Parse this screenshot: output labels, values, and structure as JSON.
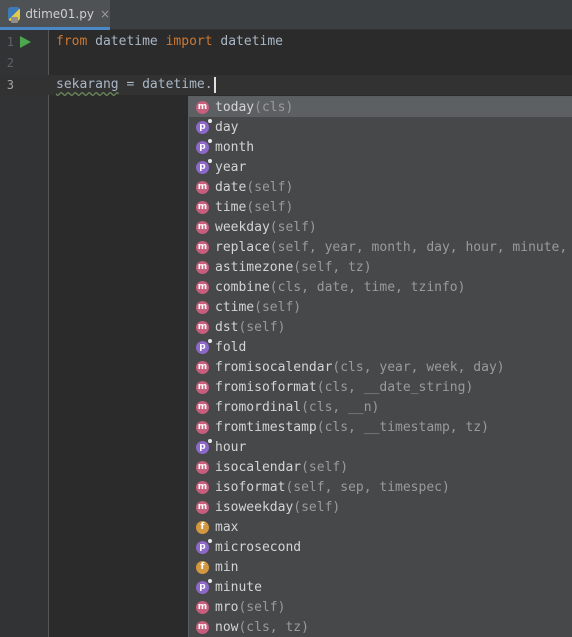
{
  "tab": {
    "filename": "dtime01.py",
    "close_symbol": "×"
  },
  "colors": {
    "keyword": "#cc7832",
    "text": "#a9b7c6",
    "method_badge": "#c75e7b",
    "property_badge": "#8c68c9",
    "field_badge": "#d3983f",
    "run": "#4ca74f"
  },
  "editor": {
    "lines": [
      {
        "number": "1",
        "kw1": "from",
        "mod": " datetime ",
        "kw2": "import",
        "name": " datetime"
      },
      {
        "number": "2"
      },
      {
        "number": "3",
        "var": "sekarang",
        "rest": " = datetime."
      }
    ]
  },
  "completion": {
    "items": [
      {
        "kind": "m",
        "name": "today",
        "sig": "(cls)"
      },
      {
        "kind": "p",
        "name": "day",
        "sig": ""
      },
      {
        "kind": "p",
        "name": "month",
        "sig": ""
      },
      {
        "kind": "p",
        "name": "year",
        "sig": ""
      },
      {
        "kind": "m",
        "name": "date",
        "sig": "(self)"
      },
      {
        "kind": "m",
        "name": "time",
        "sig": "(self)"
      },
      {
        "kind": "m",
        "name": "weekday",
        "sig": "(self)"
      },
      {
        "kind": "m",
        "name": "replace",
        "sig": "(self, year, month, day, hour, minute,"
      },
      {
        "kind": "m",
        "name": "astimezone",
        "sig": "(self, tz)"
      },
      {
        "kind": "m",
        "name": "combine",
        "sig": "(cls, date, time, tzinfo)"
      },
      {
        "kind": "m",
        "name": "ctime",
        "sig": "(self)"
      },
      {
        "kind": "m",
        "name": "dst",
        "sig": "(self)"
      },
      {
        "kind": "p",
        "name": "fold",
        "sig": ""
      },
      {
        "kind": "m",
        "name": "fromisocalendar",
        "sig": "(cls, year, week, day)"
      },
      {
        "kind": "m",
        "name": "fromisoformat",
        "sig": "(cls, __date_string)"
      },
      {
        "kind": "m",
        "name": "fromordinal",
        "sig": "(cls, __n)"
      },
      {
        "kind": "m",
        "name": "fromtimestamp",
        "sig": "(cls, __timestamp, tz)"
      },
      {
        "kind": "p",
        "name": "hour",
        "sig": ""
      },
      {
        "kind": "m",
        "name": "isocalendar",
        "sig": "(self)"
      },
      {
        "kind": "m",
        "name": "isoformat",
        "sig": "(self, sep, timespec)"
      },
      {
        "kind": "m",
        "name": "isoweekday",
        "sig": "(self)"
      },
      {
        "kind": "f",
        "name": "max",
        "sig": ""
      },
      {
        "kind": "p",
        "name": "microsecond",
        "sig": ""
      },
      {
        "kind": "f",
        "name": "min",
        "sig": ""
      },
      {
        "kind": "p",
        "name": "minute",
        "sig": ""
      },
      {
        "kind": "m",
        "name": "mro",
        "sig": "(self)"
      },
      {
        "kind": "m",
        "name": "now",
        "sig": "(cls, tz)"
      }
    ]
  }
}
